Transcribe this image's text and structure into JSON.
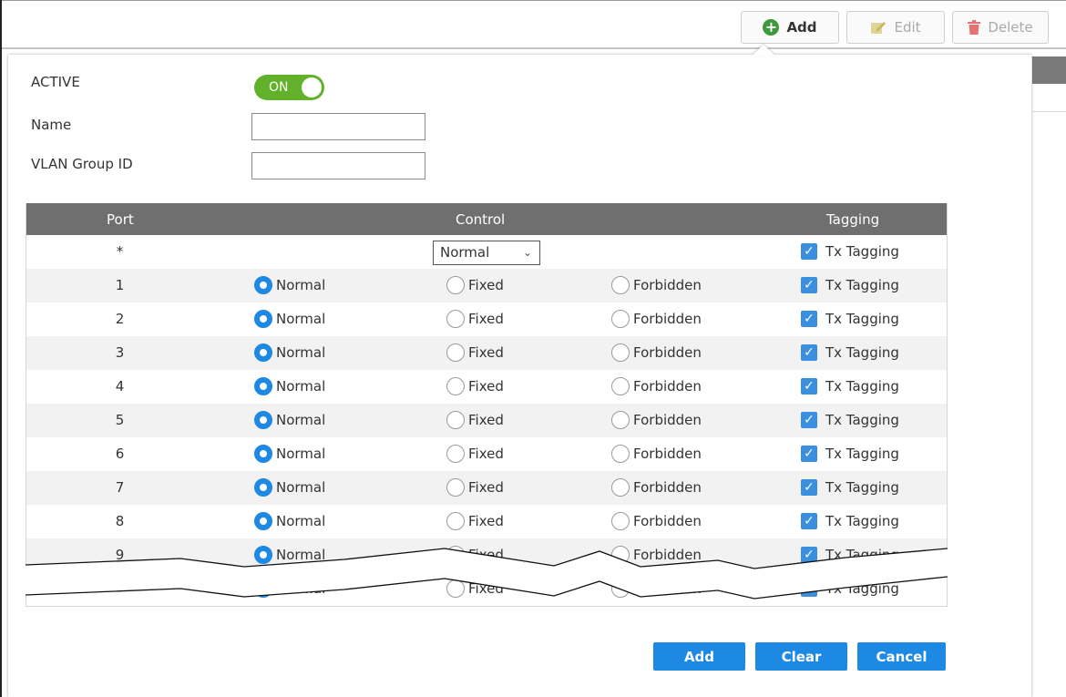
{
  "toolbar": {
    "add_label": "Add",
    "edit_label": "Edit",
    "delete_label": "Delete"
  },
  "form": {
    "active_label": "ACTIVE",
    "toggle_text": "ON",
    "name_label": "Name",
    "name_value": "",
    "vlan_group_id_label": "VLAN Group ID",
    "vlan_group_id_value": ""
  },
  "table": {
    "headers": {
      "port": "Port",
      "control": "Control",
      "tagging": "Tagging"
    },
    "all_row": {
      "port": "*",
      "control_select": "Normal",
      "tagging_label": "Tx Tagging"
    },
    "options": {
      "normal": "Normal",
      "fixed": "Fixed",
      "forbidden": "Forbidden"
    },
    "tagging_label": "Tx Tagging",
    "rows": [
      {
        "port": "1",
        "control": "Normal",
        "tx_tagging": true
      },
      {
        "port": "2",
        "control": "Normal",
        "tx_tagging": true
      },
      {
        "port": "3",
        "control": "Normal",
        "tx_tagging": true
      },
      {
        "port": "4",
        "control": "Normal",
        "tx_tagging": true
      },
      {
        "port": "5",
        "control": "Normal",
        "tx_tagging": true
      },
      {
        "port": "6",
        "control": "Normal",
        "tx_tagging": true
      },
      {
        "port": "7",
        "control": "Normal",
        "tx_tagging": true
      },
      {
        "port": "8",
        "control": "Normal",
        "tx_tagging": true
      },
      {
        "port": "9",
        "control": "Normal",
        "tx_tagging": true
      },
      {
        "port": "",
        "control": "Normal",
        "tx_tagging": true
      }
    ]
  },
  "actions": {
    "add_label": "Add",
    "clear_label": "Clear",
    "cancel_label": "Cancel"
  },
  "colors": {
    "accent": "#1e88e5",
    "toggle_on": "#62b12a",
    "header_bg": "#6f6f6f",
    "add_icon": "#3c9a3c",
    "delete_icon": "#e57373"
  }
}
